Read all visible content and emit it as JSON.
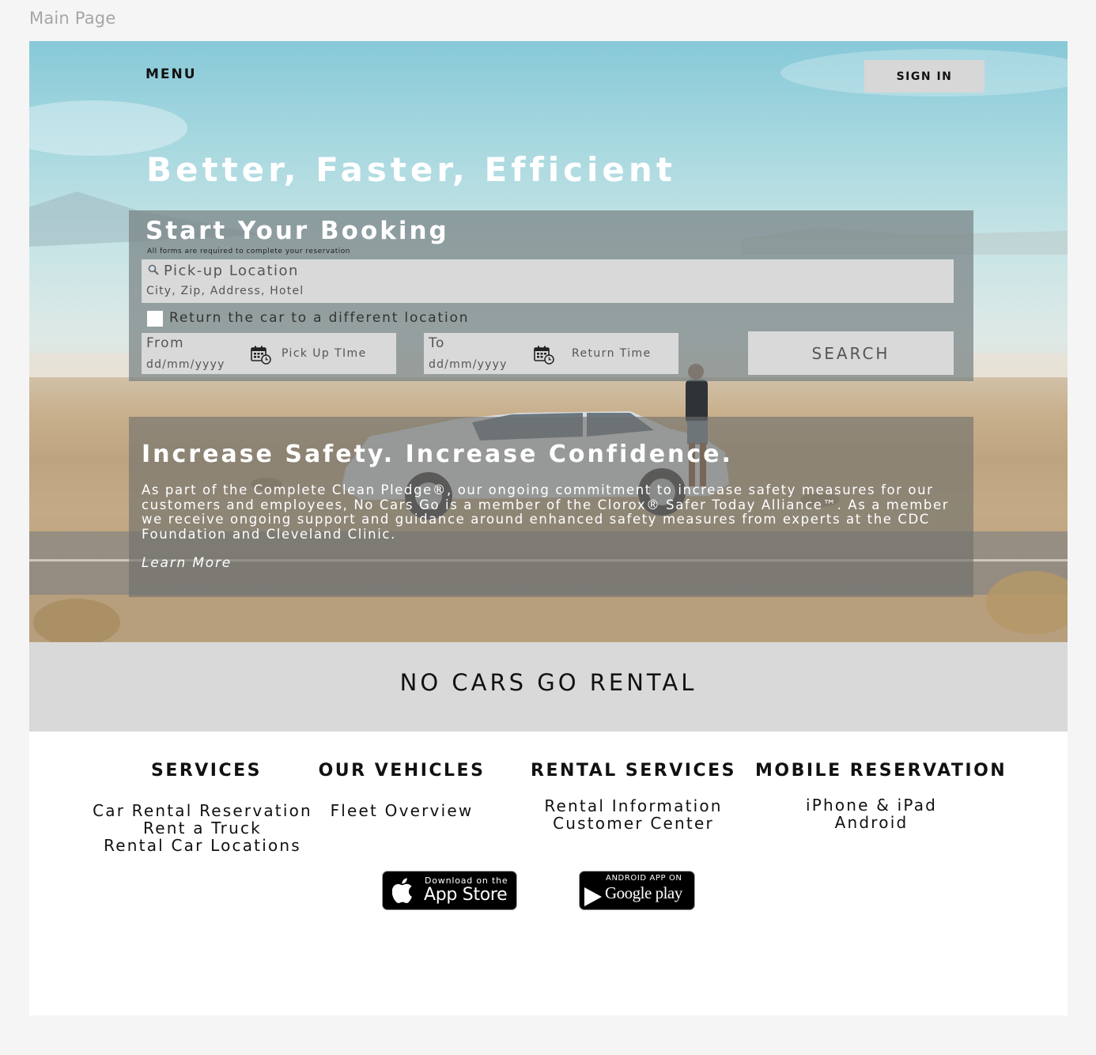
{
  "frame": {
    "label": "Main Page"
  },
  "header": {
    "menu_label": "MENU",
    "signin_label": "SIGN IN"
  },
  "hero": {
    "headline": "Better, Faster, Efficient"
  },
  "booking": {
    "title": "Start Your Booking",
    "note": "All forms are required to complete your reservation",
    "pickup_label": "Pick-up Location",
    "pickup_placeholder": "City, Zip, Address, Hotel",
    "return_label": "Return the car to a different location",
    "from_label": "From",
    "from_placeholder": "dd/mm/yyyy",
    "pickup_time_label": "Pick Up TIme",
    "to_label": "To",
    "to_placeholder": "dd/mm/yyyy",
    "return_time_label": "Return Time",
    "search_label": "SEARCH"
  },
  "safety": {
    "title": "Increase Safety. Increase Confidence.",
    "body": "As part of the Complete Clean Pledge®, our ongoing commitment to increase safety measures for our customers and employees, No Cars Go is a member of the Clorox® Safer Today Alliance™.  As a member we receive ongoing support and guidance around enhanced safety measures from experts at the CDC Foundation and Cleveland Clinic.",
    "learn_more": "Learn More"
  },
  "brand": {
    "name": "NO CARS GO RENTAL"
  },
  "footer": {
    "services": {
      "heading": "SERVICES",
      "links": [
        "Car Rental Reservation",
        "Rent a Truck",
        "Rental Car Locations"
      ]
    },
    "vehicles": {
      "heading": "OUR VEHICLES",
      "links": [
        "Fleet Overview"
      ]
    },
    "rental": {
      "heading": "RENTAL SERVICES",
      "links": [
        "Rental Information",
        "Customer Center"
      ]
    },
    "mobile": {
      "heading": "MOBILE RESERVATION",
      "links": [
        "iPhone & iPad",
        "Android"
      ]
    }
  },
  "badges": {
    "appstore_small": "Download on the",
    "appstore_big": "App Store",
    "google_small": "ANDROID APP ON",
    "google_big": "Google play"
  },
  "icons": {
    "search": "magnifier-icon",
    "calendar": "calendar-clock-icon",
    "apple": "apple-logo-icon",
    "play": "google-play-icon"
  }
}
